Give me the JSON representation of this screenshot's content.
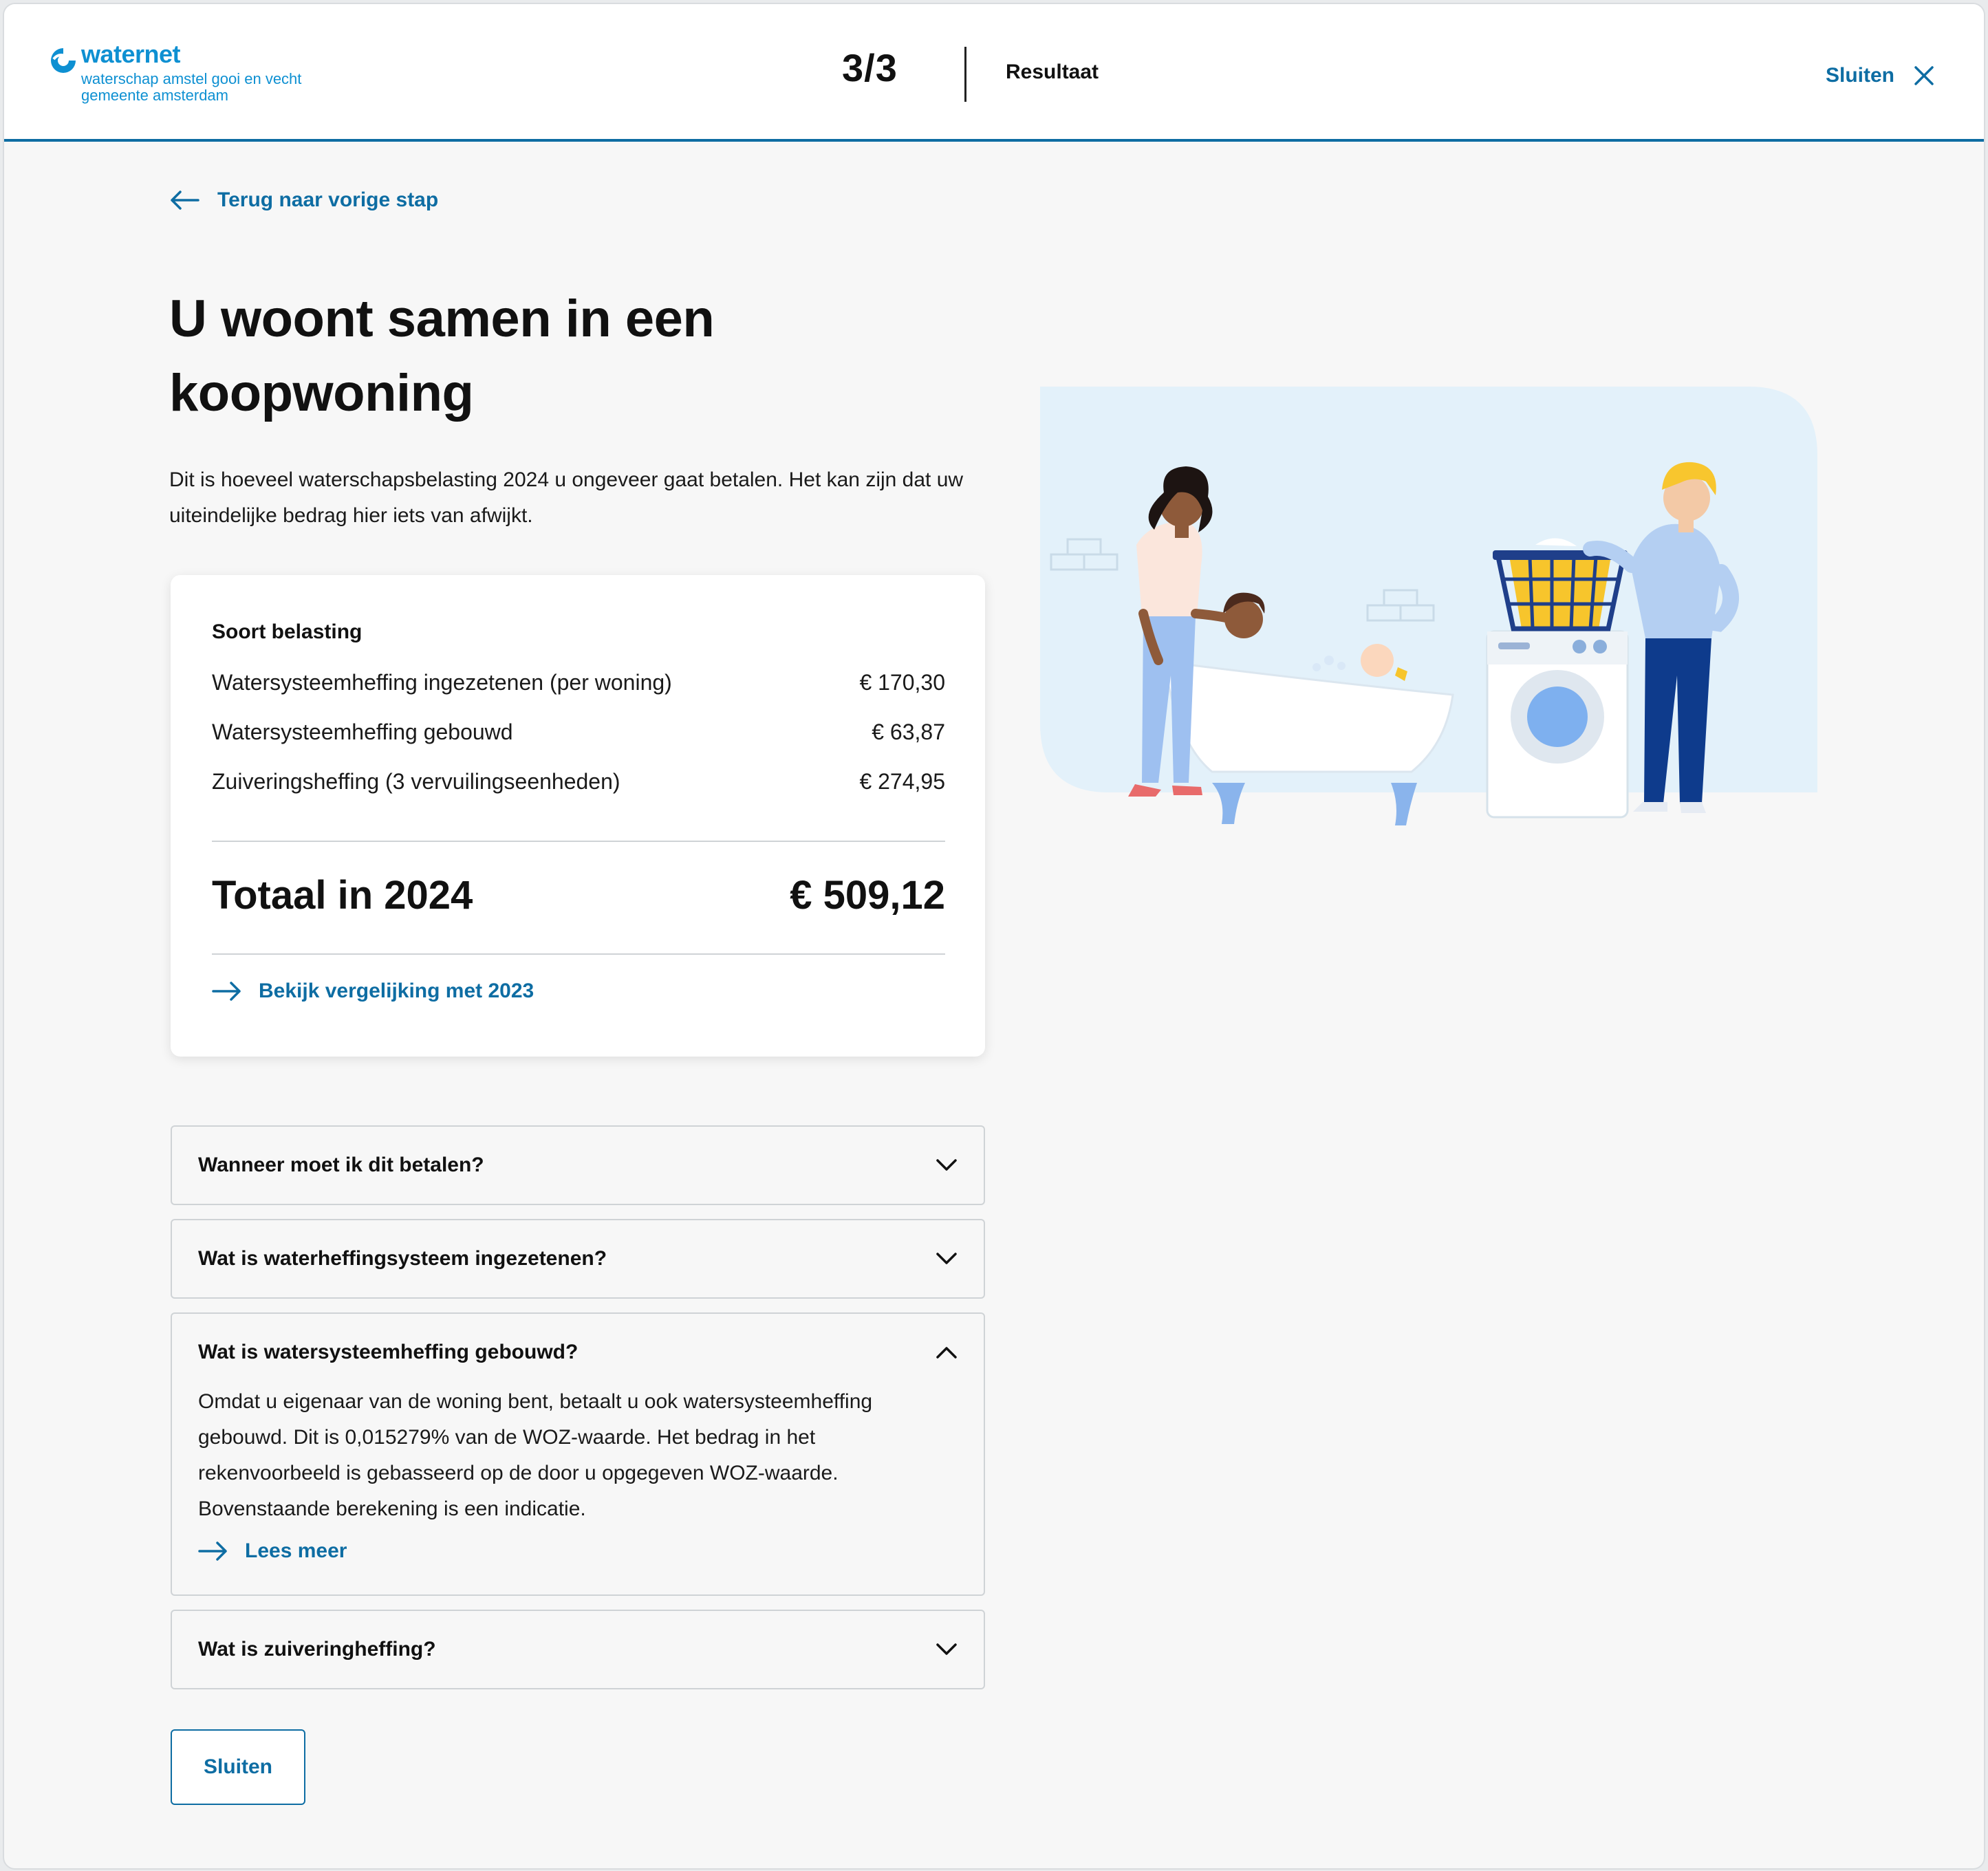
{
  "header": {
    "logo_name": "waternet",
    "logo_sub1": "waterschap amstel gooi en vecht",
    "logo_sub2": "gemeente amsterdam",
    "step": "3/3",
    "step_label": "Resultaat",
    "close_label": "Sluiten"
  },
  "back_label": "Terug naar vorige stap",
  "title": "U woont samen in een koopwoning",
  "intro": "Dit is hoeveel waterschapsbelasting 2024 u ongeveer gaat betalen. Het kan zijn dat uw uiteindelijke bedrag hier iets van afwijkt.",
  "summary": {
    "heading": "Soort belasting",
    "rows": [
      {
        "label": "Watersysteemheffing ingezetenen (per woning)",
        "amount": "€ 170,30"
      },
      {
        "label": "Watersysteemheffing gebouwd",
        "amount": "€ 63,87"
      },
      {
        "label": "Zuiveringsheffing (3 vervuilingseenheden)",
        "amount": "€ 274,95"
      }
    ],
    "total_label": "Totaal in 2024",
    "total_value": "€ 509,12",
    "compare_label": "Bekijk vergelijking met 2023"
  },
  "faq": [
    {
      "question": "Wanneer moet ik dit betalen?",
      "expanded": false
    },
    {
      "question": "Wat is waterheffingsysteem ingezetenen?",
      "expanded": false
    },
    {
      "question": "Wat is watersysteemheffing gebouwd?",
      "expanded": true,
      "answer": "Omdat u eigenaar van de woning bent, betaalt u ook watersysteemheffing gebouwd. Dit is 0,015279% van de WOZ-waarde. Het bedrag in het rekenvoorbeeld is gebasseerd op de door u opgegeven WOZ-waarde. Bovenstaande berekening is een indicatie.",
      "more_label": "Lees meer"
    },
    {
      "question": "Wat is zuiveringheffing?",
      "expanded": false
    }
  ],
  "close_button_label": "Sluiten",
  "icons": {
    "logo": "waternet-logo-icon",
    "close": "close-icon",
    "back": "arrow-left-icon",
    "forward": "arrow-right-icon",
    "expand": "chevron-down-icon",
    "collapse": "chevron-up-icon"
  },
  "colors": {
    "accent": "#0e6da3",
    "logo": "#0e90d2",
    "background": "#f7f7f7",
    "illustration_bg": "#e3f1fa"
  }
}
